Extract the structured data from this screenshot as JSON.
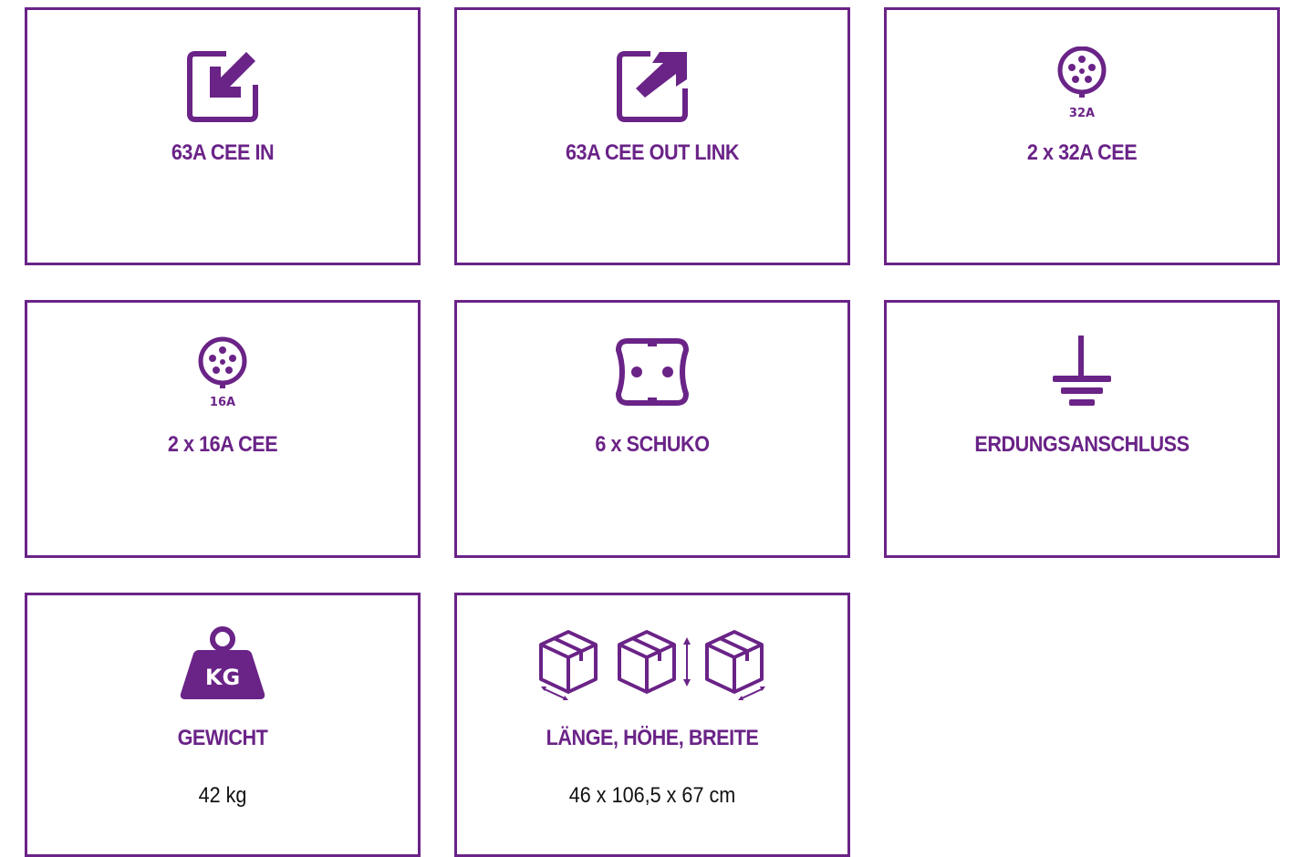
{
  "theme": {
    "accent": "#6a2387",
    "text": "#111111",
    "background": "#ffffff"
  },
  "cards": [
    {
      "icon": "input-arrow-icon",
      "label": "63A CEE IN"
    },
    {
      "icon": "output-arrow-icon",
      "label": "63A CEE OUT LINK"
    },
    {
      "icon": "cee-socket-32a-icon",
      "icon_text": "32A",
      "label": "2 x 32A CEE"
    },
    {
      "icon": "cee-socket-16a-icon",
      "icon_text": "16A",
      "label": "2 x 16A CEE"
    },
    {
      "icon": "schuko-socket-icon",
      "label": "6 x SCHUKO"
    },
    {
      "icon": "ground-symbol-icon",
      "label": "ERDUNGSANSCHLUSS"
    },
    {
      "icon": "weight-kg-icon",
      "icon_text": "KG",
      "label": "GEWICHT",
      "value": "42 kg"
    },
    {
      "icon": "box-dimensions-icon",
      "label": "LÄNGE, HÖHE, BREITE",
      "value": "46 x 106,5 x 67 cm"
    }
  ]
}
